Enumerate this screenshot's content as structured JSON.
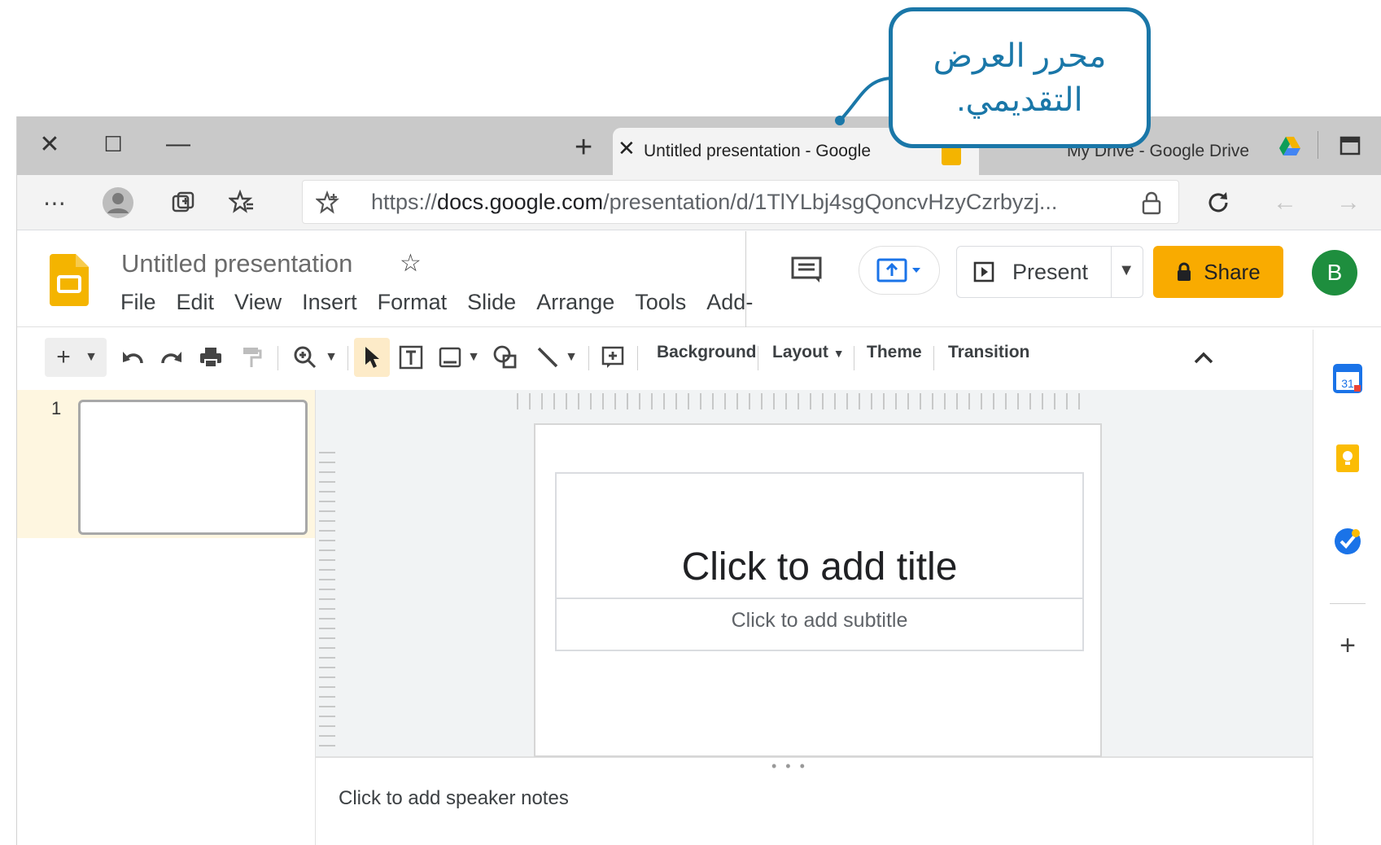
{
  "callout": {
    "line1": "محرر العرض",
    "line2": "التقديمي."
  },
  "browser": {
    "window_controls": {
      "close": "✕",
      "maximize": "☐",
      "minimize": "—"
    },
    "new_tab": "+",
    "active_tab": {
      "title": "Untitled presentation - Google ",
      "close": "✕"
    },
    "second_tab": {
      "title": "My Drive - Google Drive"
    },
    "url": {
      "prefix": "https://",
      "domain": "docs.google.com",
      "path": "/presentation/d/1TlYLbj4sgQoncvHzyCzrbyzj..."
    }
  },
  "app": {
    "doc_title": "Untitled presentation",
    "menu": [
      "File",
      "Edit",
      "View",
      "Insert",
      "Format",
      "Slide",
      "Arrange",
      "Tools",
      "Add-"
    ],
    "present_label": "Present",
    "share_label": "Share",
    "avatar_letter": "B",
    "accent_color": "#f9ab00",
    "avatar_color": "#1e8e3e"
  },
  "toolbar": {
    "background": "Background",
    "layout": "Layout",
    "theme": "Theme",
    "transition": "Transition"
  },
  "filmstrip": {
    "slide_number": "1"
  },
  "slide": {
    "title_placeholder": "Click to add title",
    "subtitle_placeholder": "Click to add subtitle"
  },
  "notes": {
    "placeholder": "Click to add speaker notes"
  },
  "callout_color": "#1a77a8"
}
